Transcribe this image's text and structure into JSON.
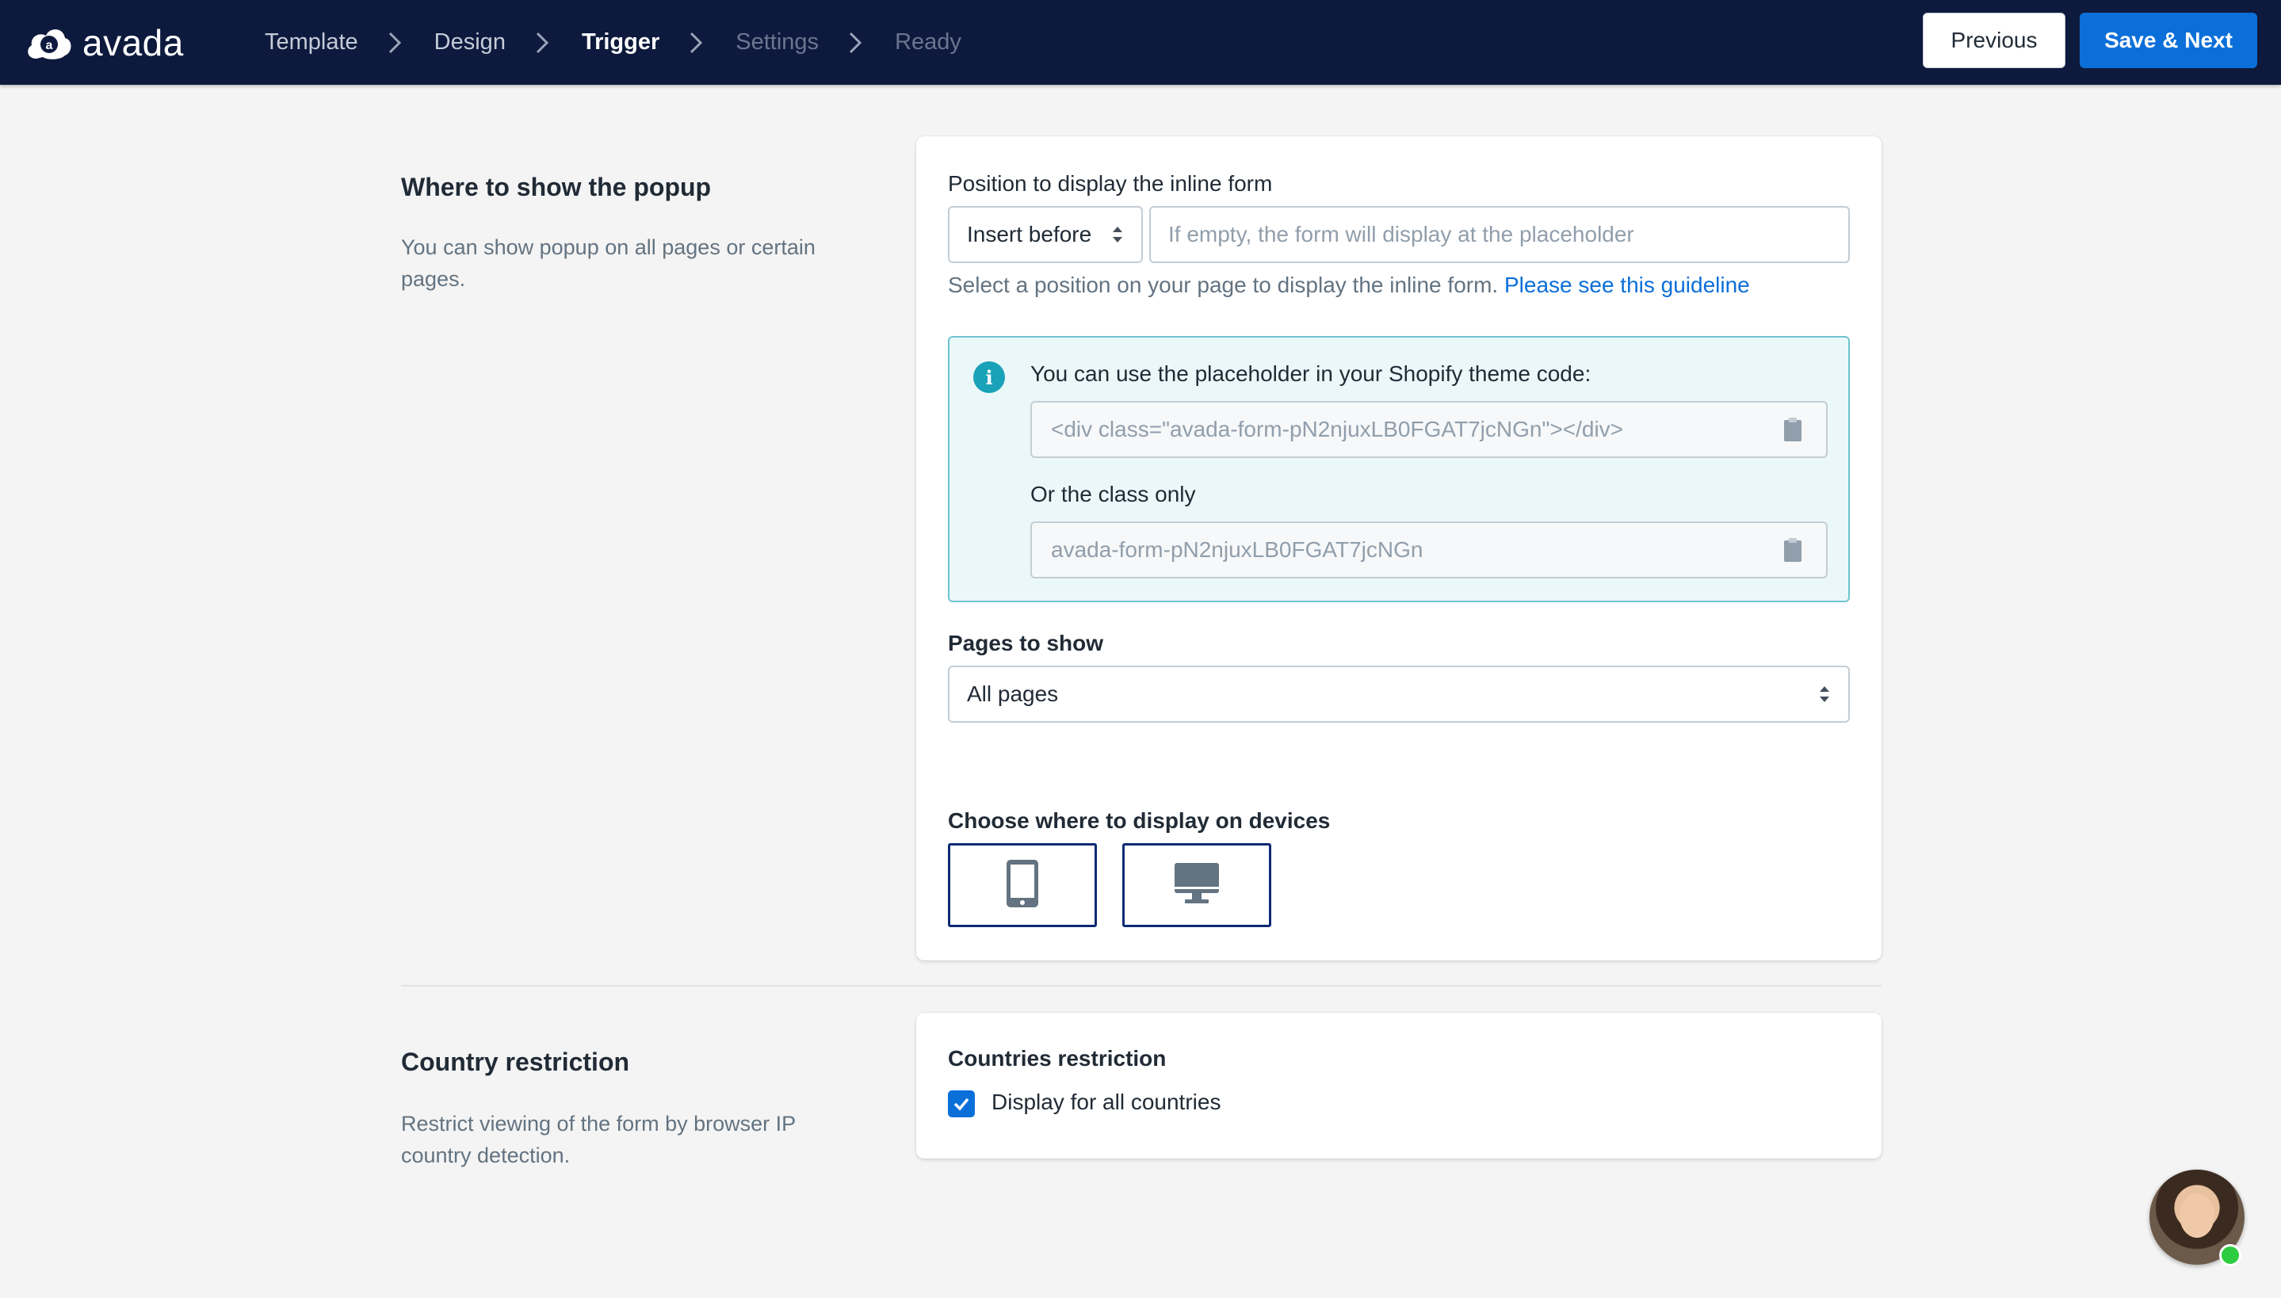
{
  "brand": {
    "name": "avada"
  },
  "steps": [
    {
      "label": "Template",
      "state": "done"
    },
    {
      "label": "Design",
      "state": "done"
    },
    {
      "label": "Trigger",
      "state": "active"
    },
    {
      "label": "Settings",
      "state": "todo"
    },
    {
      "label": "Ready",
      "state": "todo"
    }
  ],
  "toolbar": {
    "previous_label": "Previous",
    "next_label": "Save & Next"
  },
  "where": {
    "title": "Where to show the popup",
    "description": "You can show popup on all pages or certain pages.",
    "position_label": "Position to display the inline form",
    "position_select": "Insert before",
    "selector_placeholder": "If empty, the form will display at the placeholder",
    "selector_value": "",
    "helper_text": "Select a position on your page to display the inline form.",
    "guideline_link": "Please see this guideline",
    "info": {
      "heading": "You can use the placeholder in your Shopify theme code:",
      "placeholder_code": "<div class=\"avada-form-pN2njuxLB0FGAT7jcNGn\"></div>",
      "class_label": "Or the class only",
      "class_code": "avada-form-pN2njuxLB0FGAT7jcNGn"
    },
    "pages_label": "Pages to show",
    "pages_select": "All pages",
    "devices_label": "Choose where to display on devices",
    "devices": [
      {
        "name": "mobile",
        "icon": "tablet-icon",
        "selected": true
      },
      {
        "name": "desktop",
        "icon": "desktop-icon",
        "selected": true
      }
    ]
  },
  "country": {
    "title": "Country restriction",
    "description": "Restrict viewing of the form by browser IP country detection.",
    "card_label": "Countries restriction",
    "checkbox_label": "Display for all countries",
    "checked": true
  },
  "colors": {
    "topbar": "#0d1a3d",
    "primary": "#0b6fd9",
    "info_bg": "#ebf8fa",
    "info_border": "#6fc4cf",
    "device_border": "#0d2a73"
  }
}
